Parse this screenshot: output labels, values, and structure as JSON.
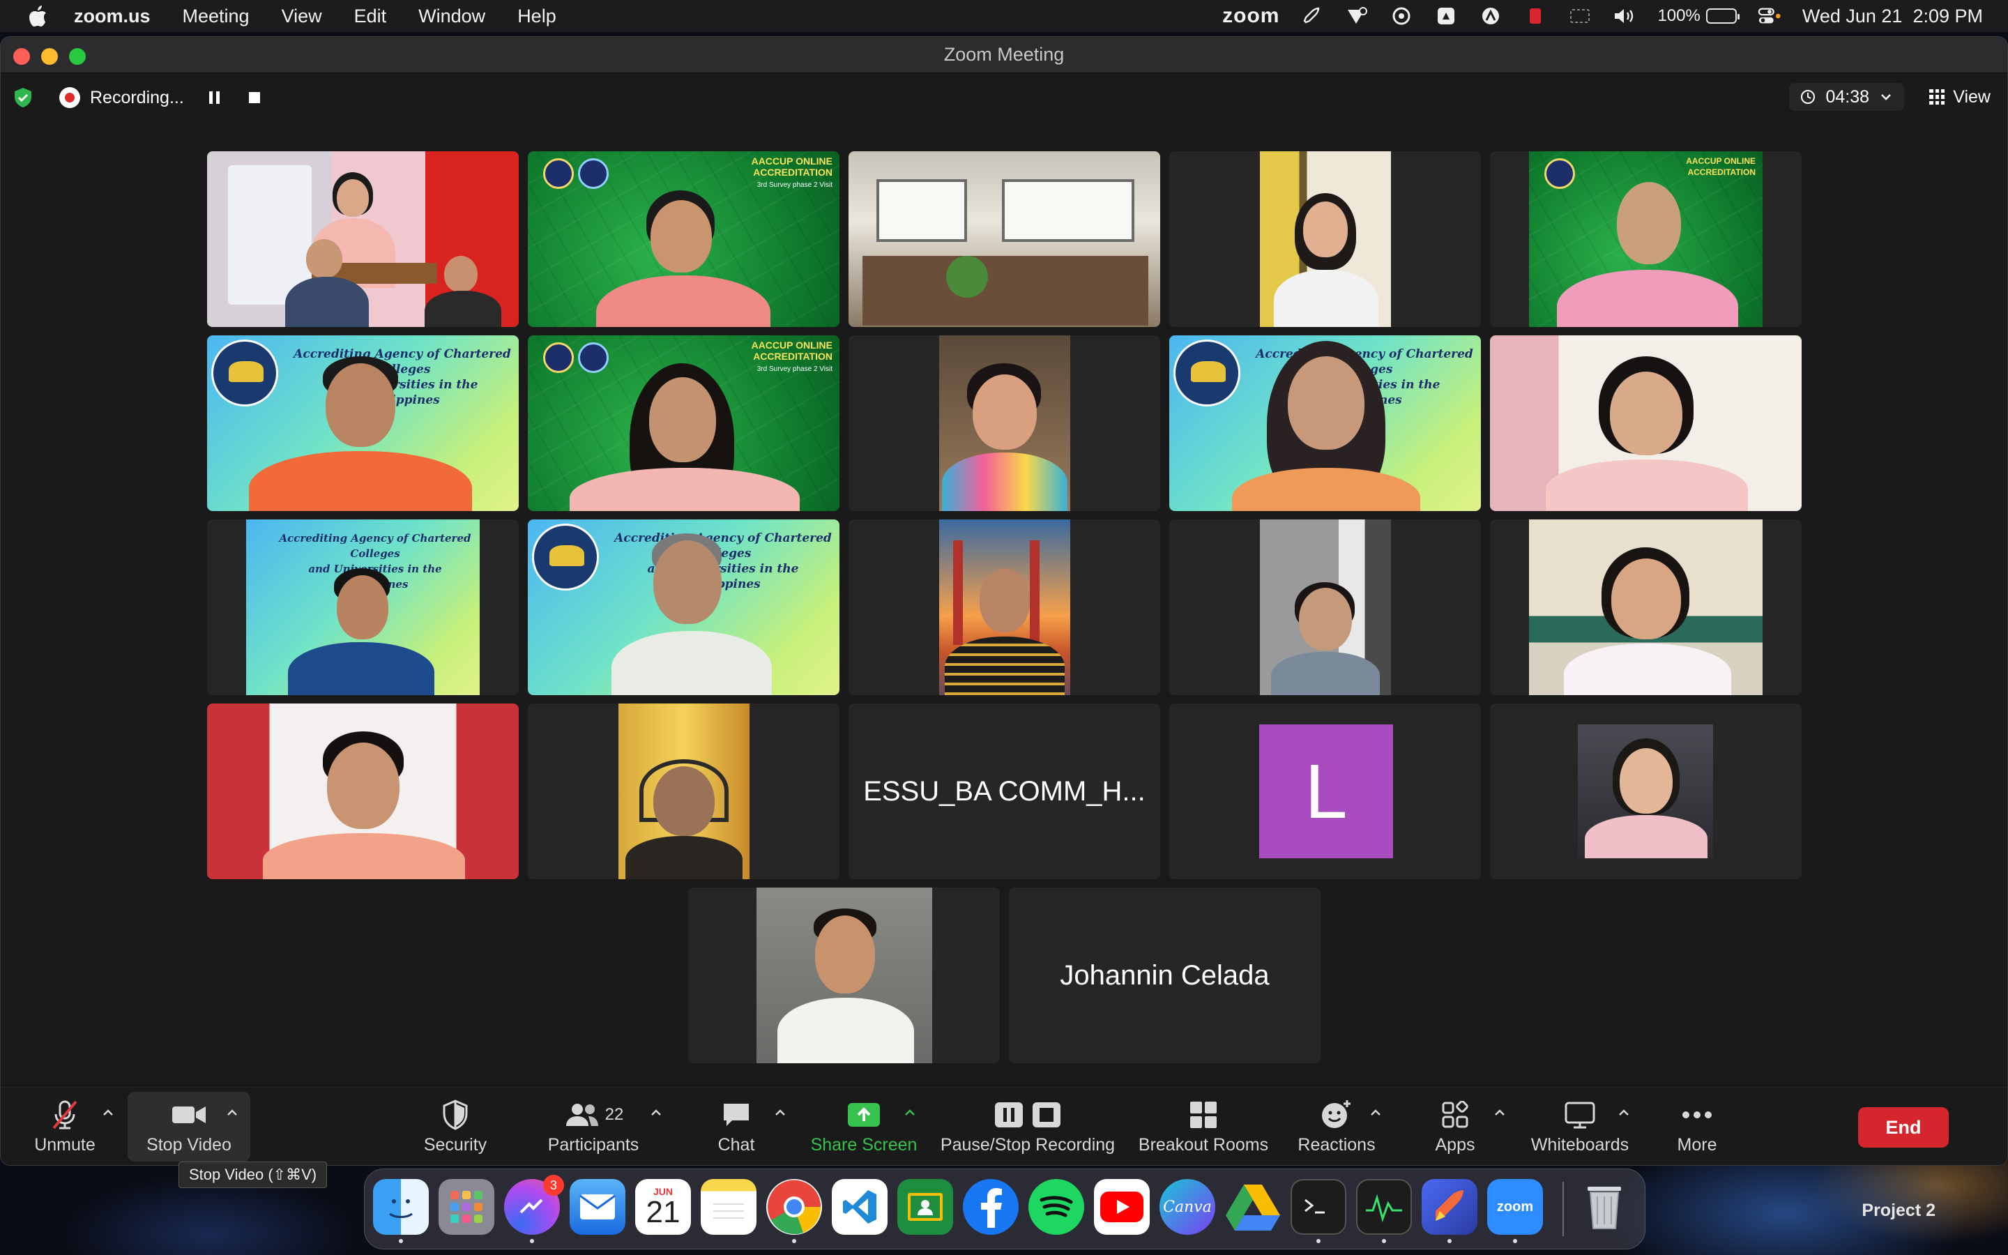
{
  "menubar": {
    "app_name": "zoom.us",
    "menus": [
      "Meeting",
      "View",
      "Edit",
      "Window",
      "Help"
    ],
    "zoom_status": "zoom",
    "battery_percent": "100%",
    "battery_level": 1.0,
    "datetime": "Wed Jun 21  2:09 PM"
  },
  "window": {
    "title": "Zoom Meeting",
    "recording_label": "Recording...",
    "timer": "04:38",
    "view_label": "View"
  },
  "gallery": {
    "name_tiles": {
      "essu": "ESSU_BA COMM_H...",
      "johannin": "Johannin Celada",
      "avatar_letter": "L"
    },
    "banner_texts": {
      "aaccup_line1": "Accrediting Agency of Chartered Colleges",
      "aaccup_line2": "and Universities in the Philippines",
      "online_title1": "AACCUP ONLINE",
      "online_title2": "ACCREDITATION",
      "online_sub": "3rd Survey phase 2 Visit"
    }
  },
  "toolbar": {
    "unmute": "Unmute",
    "stop_video": "Stop Video",
    "security": "Security",
    "participants": "Participants",
    "participants_count": "22",
    "chat": "Chat",
    "share_screen": "Share Screen",
    "pause_stop_recording": "Pause/Stop Recording",
    "breakout_rooms": "Breakout Rooms",
    "reactions": "Reactions",
    "apps": "Apps",
    "whiteboards": "Whiteboards",
    "more": "More",
    "end": "End",
    "tooltip": "Stop Video (⇧⌘V)"
  },
  "dock": {
    "messenger_badge": "3",
    "calendar_month": "JUN",
    "calendar_day": "21",
    "canva_label": "Canva",
    "zoom_label": "zoom",
    "desktop_label": "Project 2"
  },
  "colors": {
    "active_speaker": "#5fd35f",
    "end_button": "#d5262e",
    "share_screen": "#36c24d",
    "recording_dot": "#e02b2b"
  }
}
